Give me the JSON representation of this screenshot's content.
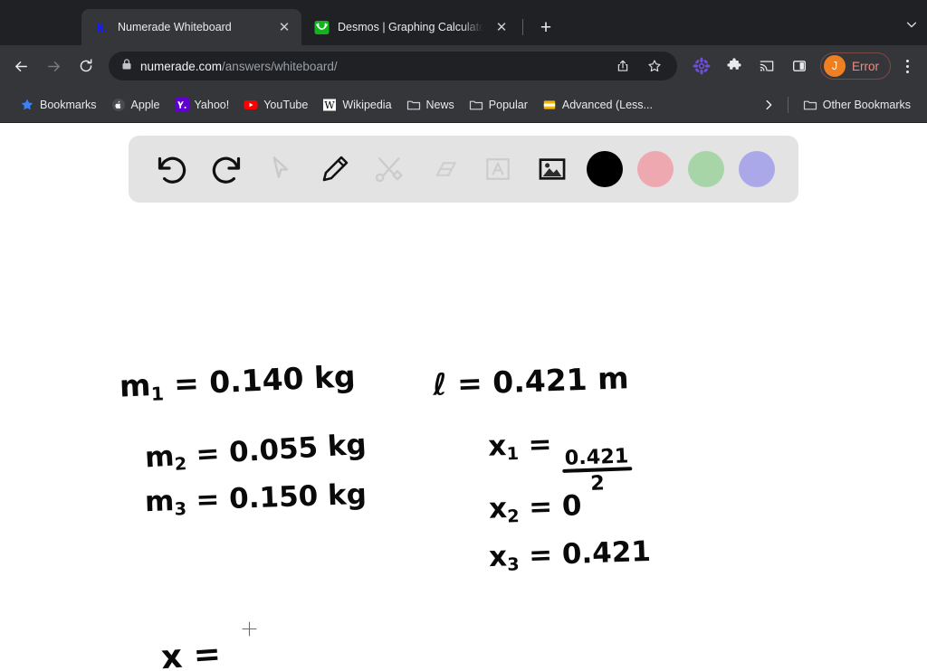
{
  "browser": {
    "tabs": [
      {
        "title": "Numerade Whiteboard",
        "favicon": "numerade-icon",
        "active": true,
        "close_label": "✕"
      },
      {
        "title": "Desmos | Graphing Calculato",
        "favicon": "desmos-icon",
        "active": false,
        "close_label": "✕"
      }
    ],
    "new_tab_label": "+",
    "tabstrip_chevron": "chevron-down-icon",
    "nav": {
      "back": "back-arrow-icon",
      "forward": "forward-arrow-icon",
      "reload": "reload-icon"
    },
    "omnibox": {
      "lock": "lock-icon",
      "url_host": "numerade.com",
      "url_path": "/answers/whiteboard/",
      "share": "share-icon",
      "bookmark_star": "star-icon"
    },
    "extensions": [
      {
        "name": "flower-extension-icon",
        "color": "#6d4fdb"
      },
      {
        "name": "puzzle-extensions-icon",
        "color": "#e8eaed"
      },
      {
        "name": "cast-icon",
        "color": "#e8eaed"
      },
      {
        "name": "side-panel-icon",
        "color": "#e8eaed"
      }
    ],
    "profile": {
      "initial": "J",
      "label": "Error",
      "avatar_color": "#ef8022",
      "label_color": "#f28b82"
    },
    "menu": "three-dot-menu-icon",
    "bookmarks": [
      {
        "label": "Bookmarks",
        "icon": "star-bookmark-icon"
      },
      {
        "label": "Apple",
        "icon": "apple-icon"
      },
      {
        "label": "Yahoo!",
        "icon": "yahoo-icon"
      },
      {
        "label": "YouTube",
        "icon": "youtube-icon"
      },
      {
        "label": "Wikipedia",
        "icon": "wikipedia-icon"
      },
      {
        "label": "News",
        "icon": "folder-icon"
      },
      {
        "label": "Popular",
        "icon": "folder-icon"
      },
      {
        "label": "Advanced (Less...",
        "icon": "yellow-folder-icon"
      }
    ],
    "bookmarks_overflow": "›",
    "other_bookmarks": {
      "label": "Other Bookmarks",
      "icon": "folder-icon"
    }
  },
  "whiteboard": {
    "toolbar": {
      "tools": [
        {
          "name": "undo-tool",
          "enabled": true
        },
        {
          "name": "redo-tool",
          "enabled": true
        },
        {
          "name": "select-cursor-tool",
          "enabled": false
        },
        {
          "name": "pencil-tool",
          "enabled": true
        },
        {
          "name": "shapes-tool",
          "enabled": false
        },
        {
          "name": "eraser-tool",
          "enabled": false
        },
        {
          "name": "text-tool",
          "enabled": false
        },
        {
          "name": "image-tool",
          "enabled": true
        }
      ],
      "colors": [
        {
          "name": "color-black",
          "hex": "#000000"
        },
        {
          "name": "color-pink",
          "hex": "#eda8b0"
        },
        {
          "name": "color-green",
          "hex": "#a8d5a8"
        },
        {
          "name": "color-purple",
          "hex": "#aaa8e8"
        }
      ]
    },
    "notes": {
      "m1": {
        "symbol": "m",
        "sub": "1",
        "eq": "= 0.140 kg"
      },
      "m2": {
        "symbol": "m",
        "sub": "2",
        "eq": "= 0.055 kg"
      },
      "m3": {
        "symbol": "m",
        "sub": "3",
        "eq": "= 0.150 kg"
      },
      "length": {
        "symbol": "ℓ",
        "eq": "= 0.421 m"
      },
      "x1": {
        "symbol": "x",
        "sub": "1",
        "eq": "=",
        "num": "0.421",
        "den": "2"
      },
      "x2": {
        "symbol": "x",
        "sub": "2",
        "eq": "= 0"
      },
      "x3": {
        "symbol": "x",
        "sub": "3",
        "eq": "= 0.421"
      },
      "x_result": {
        "symbol": "x",
        "eq": "="
      }
    },
    "cursor": "crosshair-cursor-icon"
  }
}
